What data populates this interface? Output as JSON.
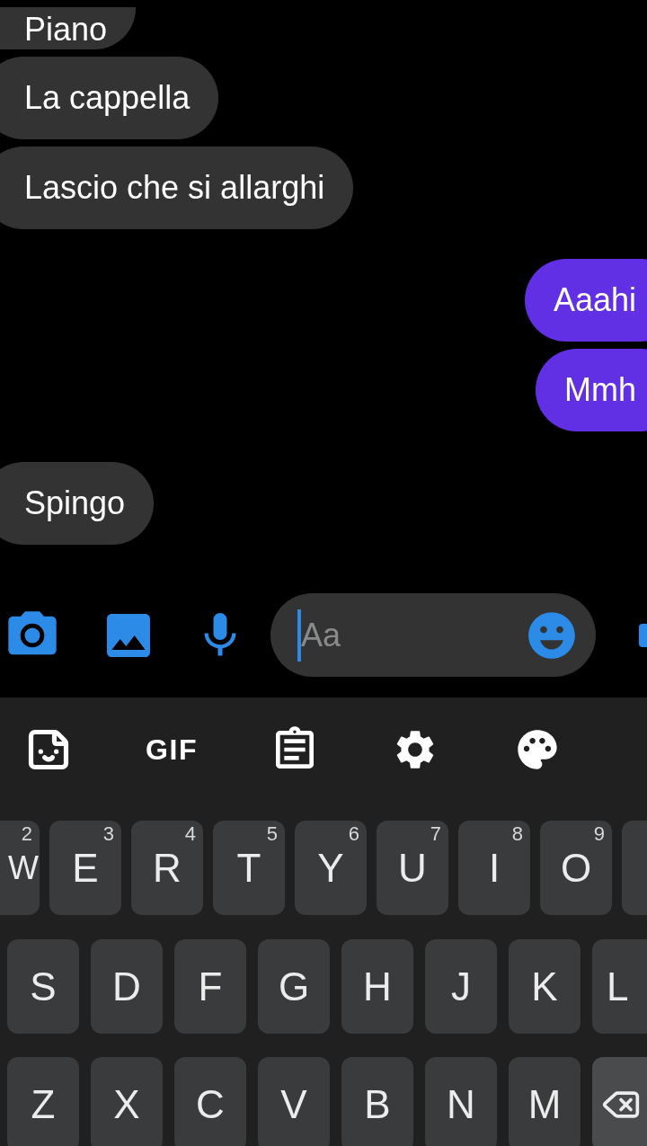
{
  "messages": [
    {
      "text": "Piano",
      "kind": "incoming"
    },
    {
      "text": "La cappella",
      "kind": "incoming"
    },
    {
      "text": "Lascio che si allarghi",
      "kind": "incoming"
    },
    {
      "text": "Aaahi",
      "kind": "outgoing"
    },
    {
      "text": "Mmh",
      "kind": "outgoing"
    },
    {
      "text": "Spingo",
      "kind": "incoming"
    }
  ],
  "composer": {
    "placeholder": "Aa"
  },
  "keyboard_toolbar": {
    "gif_label": "GIF"
  },
  "keyboard": {
    "rows": [
      [
        {
          "label": "W",
          "hint": "2"
        },
        {
          "label": "E",
          "hint": "3"
        },
        {
          "label": "R",
          "hint": "4"
        },
        {
          "label": "T",
          "hint": "5"
        },
        {
          "label": "Y",
          "hint": "6"
        },
        {
          "label": "U",
          "hint": "7"
        },
        {
          "label": "I",
          "hint": "8"
        },
        {
          "label": "O",
          "hint": "9"
        }
      ],
      [
        {
          "label": "S"
        },
        {
          "label": "D"
        },
        {
          "label": "F"
        },
        {
          "label": "G"
        },
        {
          "label": "H"
        },
        {
          "label": "J"
        },
        {
          "label": "K"
        },
        {
          "label": "L"
        }
      ],
      [
        {
          "label": "Z"
        },
        {
          "label": "X"
        },
        {
          "label": "C"
        },
        {
          "label": "V"
        },
        {
          "label": "B"
        },
        {
          "label": "N"
        },
        {
          "label": "M"
        }
      ]
    ]
  }
}
